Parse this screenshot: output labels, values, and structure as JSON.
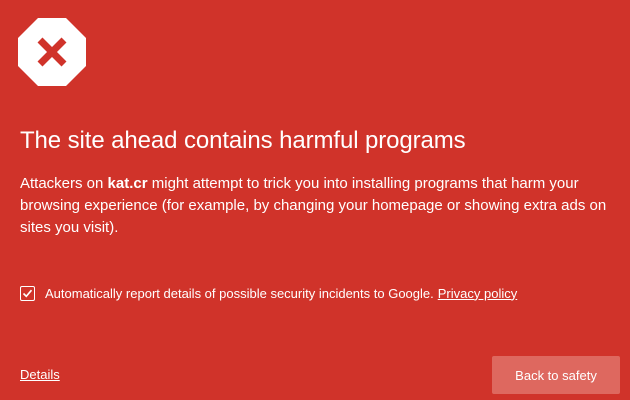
{
  "warning": {
    "icon": "red-x-octagon-icon",
    "title": "The site ahead contains harmful programs",
    "body_prefix": "Attackers on ",
    "site": "kat.cr",
    "body_suffix": " might attempt to trick you into installing programs that harm your browsing experience (for example, by changing your homepage or showing extra ads on sites you visit)."
  },
  "report": {
    "checked": true,
    "label": "Automatically report details of possible security incidents to Google.",
    "privacy_link": "Privacy policy"
  },
  "footer": {
    "details_link": "Details",
    "back_button": "Back to safety"
  },
  "colors": {
    "background": "#d0332a",
    "button": "#de685f",
    "text": "#ffffff",
    "icon_x": "#d0332a"
  }
}
